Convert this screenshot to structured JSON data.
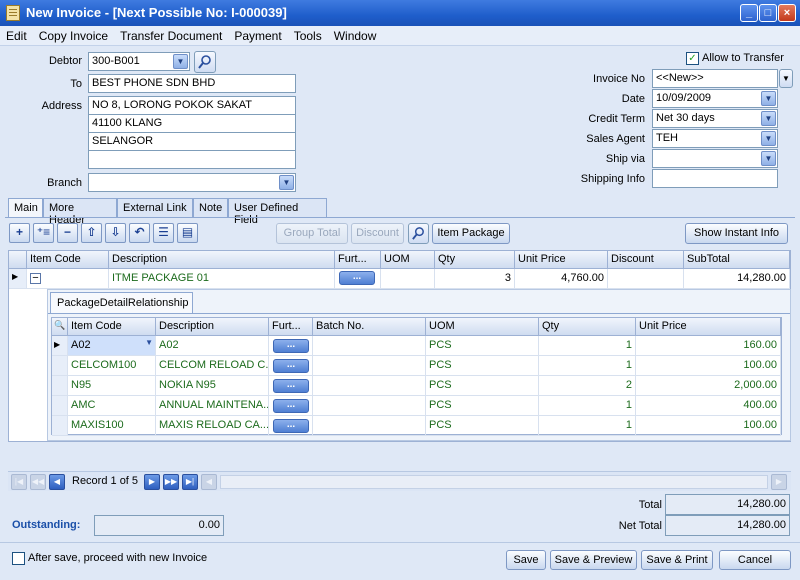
{
  "window": {
    "title": "New Invoice - [Next Possible No: I-000039]",
    "min_glyph": "_",
    "max_glyph": "□",
    "close_glyph": "×"
  },
  "menu": [
    "Edit",
    "Copy Invoice",
    "Transfer Document",
    "Payment",
    "Tools",
    "Window"
  ],
  "header": {
    "debtor_label": "Debtor",
    "debtor_value": "300-B001",
    "to_label": "To",
    "to_value": "BEST PHONE SDN BHD",
    "address_label": "Address",
    "address": [
      "NO 8, LORONG POKOK SAKAT",
      "41100 KLANG",
      "SELANGOR",
      ""
    ],
    "branch_label": "Branch",
    "branch_value": "",
    "allow_transfer_label": "Allow to Transfer",
    "allow_transfer_checked": true,
    "invoice_no_label": "Invoice No",
    "invoice_no_value": "<<New>>",
    "date_label": "Date",
    "date_value": "10/09/2009",
    "credit_term_label": "Credit Term",
    "credit_term_value": "Net 30 days",
    "sales_agent_label": "Sales Agent",
    "sales_agent_value": "TEH",
    "ship_via_label": "Ship via",
    "ship_via_value": "",
    "shipping_info_label": "Shipping Info",
    "shipping_info_value": ""
  },
  "tabs": [
    "Main",
    "More Header",
    "External Link",
    "Note",
    "User Defined Field"
  ],
  "toolbar": {
    "icons": [
      "plus",
      "insert",
      "minus",
      "up",
      "down",
      "undo",
      "list",
      "detail"
    ],
    "group_total": "Group Total",
    "discount": "Discount",
    "item_package": "Item Package",
    "show_instant_info": "Show Instant Info"
  },
  "grid": {
    "columns": [
      "Item Code",
      "Description",
      "Furt...",
      "UOM",
      "Qty",
      "Unit Price",
      "Discount",
      "SubTotal"
    ],
    "row": {
      "item_code": "",
      "description": "ITME PACKAGE 01",
      "uom": "",
      "qty": "3",
      "unit_price": "4,760.00",
      "discount": "",
      "subtotal": "14,280.00",
      "expand_glyph": "−"
    },
    "detail_tab": "PackageDetailRelationship",
    "detail_columns": [
      "Item Code",
      "Description",
      "Furt...",
      "Batch No.",
      "UOM",
      "Qty",
      "Unit Price"
    ],
    "detail_rows": [
      {
        "item_code": "A02",
        "description": "A02",
        "batch": "",
        "uom": "PCS",
        "qty": "1",
        "unit_price": "160.00"
      },
      {
        "item_code": "CELCOM100",
        "description": "CELCOM RELOAD C...",
        "batch": "",
        "uom": "PCS",
        "qty": "1",
        "unit_price": "100.00"
      },
      {
        "item_code": "N95",
        "description": "NOKIA N95",
        "batch": "",
        "uom": "PCS",
        "qty": "2",
        "unit_price": "2,000.00"
      },
      {
        "item_code": "AMC",
        "description": "ANNUAL MAINTENA...",
        "batch": "",
        "uom": "PCS",
        "qty": "1",
        "unit_price": "400.00"
      },
      {
        "item_code": "MAXIS100",
        "description": "MAXIS RELOAD CA...",
        "batch": "",
        "uom": "PCS",
        "qty": "1",
        "unit_price": "100.00"
      }
    ],
    "ellipsis": "..."
  },
  "navigator": {
    "record_text": "Record 1 of 5"
  },
  "footer": {
    "total_label": "Total",
    "total_value": "14,280.00",
    "outstanding_label": "Outstanding:",
    "outstanding_value": "0.00",
    "net_total_label": "Net Total",
    "net_total_value": "14,280.00",
    "proceed_label": "After save, proceed with new Invoice",
    "save": "Save",
    "save_preview": "Save & Preview",
    "save_print": "Save & Print",
    "cancel": "Cancel"
  },
  "colors": {
    "title_bar": "#1f5ecb",
    "form_bg": "#dfe8f6",
    "detail_text_green": "#1c6b1c",
    "outstanding_blue": "#1a4fa8"
  }
}
